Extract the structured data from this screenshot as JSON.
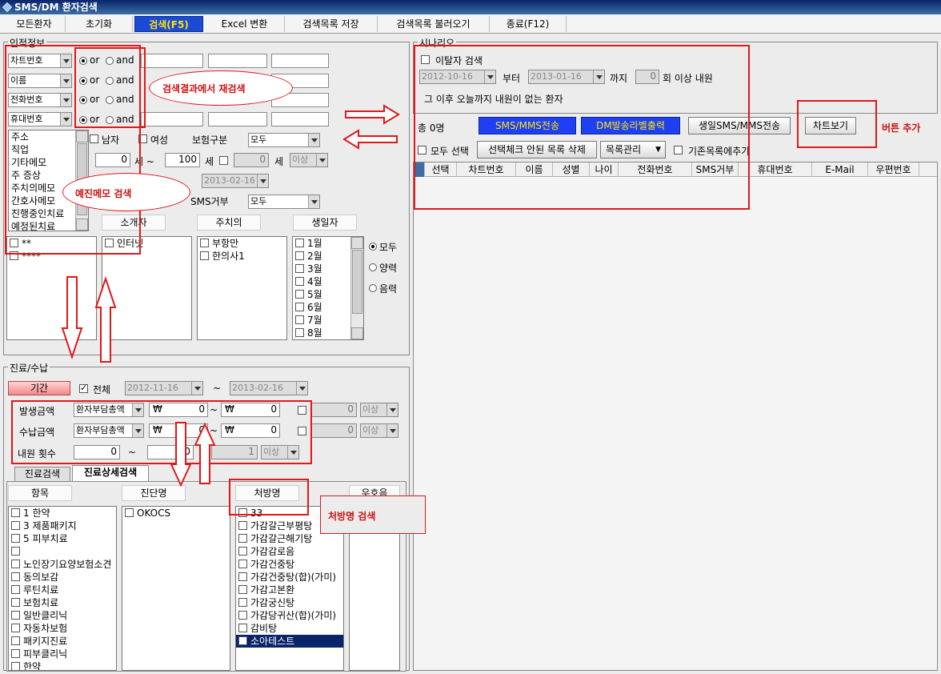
{
  "window": {
    "title": "SMS/DM 환자검색"
  },
  "menu": [
    {
      "label": "모든환자"
    },
    {
      "label": "초기화"
    },
    {
      "label": "검색(F5)"
    },
    {
      "label": "Excel 변환"
    },
    {
      "label": "검색목록 저장"
    },
    {
      "label": "검색목록 불러오기"
    },
    {
      "label": "종료(F12)"
    }
  ],
  "personal": {
    "title": "인적정보",
    "rows": [
      {
        "field": "차트번호",
        "or": "or",
        "and": "and"
      },
      {
        "field": "이름",
        "or": "or",
        "and": "and"
      },
      {
        "field": "전화번호",
        "or": "or",
        "and": "and"
      },
      {
        "field": "휴대번호",
        "or": "or",
        "and": "and"
      }
    ],
    "memo_list": [
      "주소",
      "직업",
      "기타메모",
      "주 증상",
      "주치의메모",
      "간호사메모",
      "진행중인치료",
      "예정된치료"
    ],
    "male": "남자",
    "female": "여성",
    "insurance_label": "보험구분",
    "insurance_value": "모두",
    "age_from": "0",
    "age_sep": "세 ~",
    "age_to": "100",
    "age_unit": "세",
    "age2_value": "0",
    "age2_unit": "세",
    "age2_cmp": "이상",
    "date_value": "2013-02-16",
    "sms_refuse_label": "SMS거부",
    "sms_refuse_value": "모두",
    "headers": {
      "referrer": "소개자",
      "doctor": "주치의",
      "birth_month": "생일자"
    },
    "referrer_list": [
      "**",
      "****"
    ],
    "referrer2_list": [
      "인터넷"
    ],
    "doctor_list": [
      "부항만",
      "한의사1"
    ],
    "months": [
      "1월",
      "2월",
      "3월",
      "4월",
      "5월",
      "6월",
      "7월",
      "8월"
    ],
    "calendar": {
      "all": "모두",
      "solar": "양력",
      "lunar": "음력"
    }
  },
  "treatment": {
    "title": "진료/수납",
    "period_label": "기간",
    "all_label": "전체",
    "date_from": "2012-11-16",
    "tilde": "~",
    "date_to": "2013-02-16",
    "rows": [
      {
        "label": "발생금액",
        "kind": "환자부담총액",
        "from": "0",
        "to": "0",
        "cnt": "0",
        "cmp": "이상"
      },
      {
        "label": "수납금액",
        "kind": "환자부담총액",
        "from": "0",
        "to": "0",
        "cnt": "0",
        "cmp": "이상"
      }
    ],
    "won": "₩",
    "visit_label": "내원 횟수",
    "visit_from": "0",
    "visit_to": "0",
    "visit_cnt": "1",
    "visit_cmp": "이상",
    "tabs": [
      "진료검색",
      "진료상세검색"
    ],
    "col_headers": {
      "item": "항목",
      "diagnosis": "진단명",
      "prescription": "처방명",
      "other": "우호음"
    },
    "items": [
      "1 한약",
      "3 제품패키지",
      "5 피부치료",
      "",
      "노인장기요양보험소견",
      "동의보감",
      "루틴치료",
      "보험치료",
      "일반클리닉",
      "자동차보험",
      "패키지진료",
      "피부클리닉",
      "한약"
    ],
    "diagnoses": [
      "OKOCS"
    ],
    "prescriptions": [
      "33",
      "가감갈근부평탕",
      "가감갈근해기탕",
      "가감감로음",
      "가감건중탕",
      "가감건중탕(합)(가미)",
      "가감고본환",
      "가감궁신탕",
      "가감당귀산(합)(가미)",
      "감비탕",
      "소아테스트"
    ]
  },
  "scenario": {
    "title": "시나리오",
    "dropout_label": "이탈자 검색",
    "from_date": "2012-10-16",
    "from_label": "부터",
    "to_date": "2013-01-16",
    "to_label": "까지",
    "visit_count": "0",
    "visit_suffix": "회 이상 내원",
    "after_note": "그 이후 오늘까지 내원이 없는 환자"
  },
  "results": {
    "total": "총 0명",
    "sms_btn": "SMS/MMS전송",
    "dm_btn": "DM발송라벨출력",
    "birthday_btn": "생일SMS/MMS전송",
    "chart_btn": "차트보기",
    "select_all": "모두 선택",
    "delete_unchecked": "선택체크 안된 목록 삭제",
    "list_manage": "목록관리",
    "append_existing": "기존목록에추가",
    "columns": [
      "선택",
      "차트번호",
      "이름",
      "성별",
      "나이",
      "전화번호",
      "SMS거부",
      "휴대번호",
      "E-Mail",
      "우편번호"
    ]
  },
  "annotations": {
    "research": "검색결과에서 재검색",
    "memo_search": "예진메모 검색",
    "add_button": "버튼 추가",
    "prescription_search": "처방명 검색"
  },
  "colors": {
    "annotation": "#e01818",
    "active_menu": "#1a4bd6",
    "blue_button": "#1f3ff5",
    "yellow_text": "#ffe800"
  }
}
